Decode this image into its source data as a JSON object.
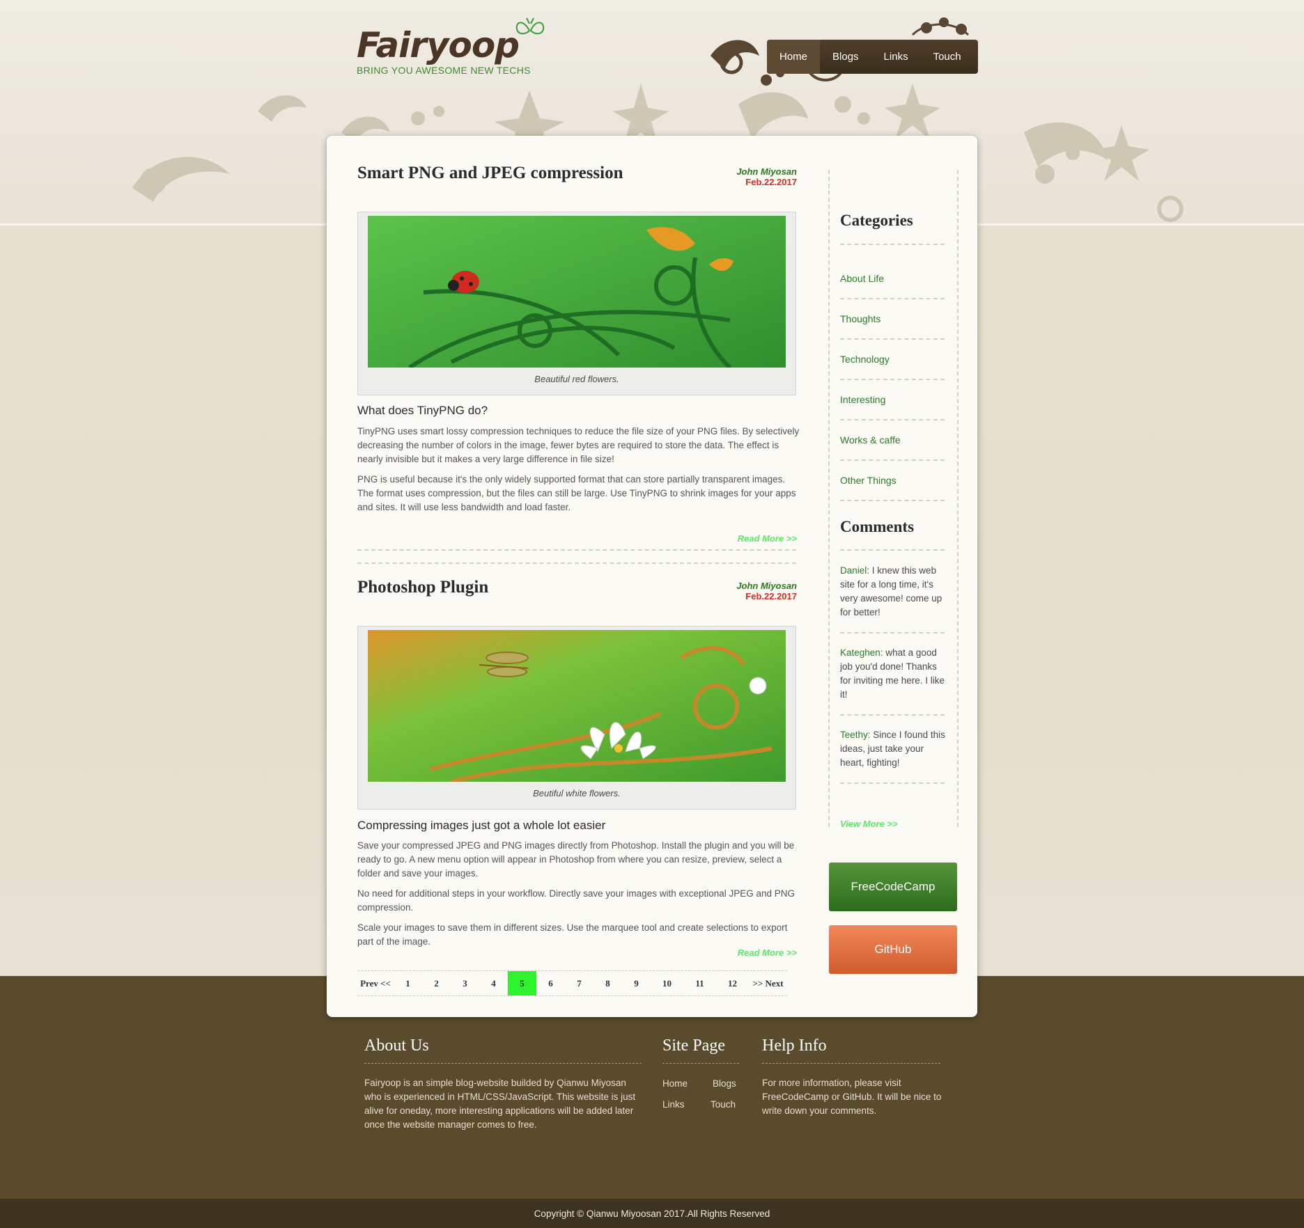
{
  "site": {
    "logo": "Fairyoop",
    "tagline": "BRING YOU AWESOME NEW TECHS"
  },
  "nav": {
    "items": [
      "Home",
      "Blogs",
      "Links",
      "Touch"
    ],
    "active": "Home"
  },
  "posts": [
    {
      "title": "Smart PNG and JPEG compression",
      "author": "John Miyosan",
      "date": "Feb.22.2017",
      "image_caption": "Beautiful red flowers.",
      "subheading": "What does TinyPNG do?",
      "paragraphs": [
        "TinyPNG uses smart lossy compression techniques to reduce the file size of your PNG files. By selectively decreasing the number of colors in the image, fewer bytes are required to store the data. The effect is nearly invisible but it makes a very large difference in file size!",
        "PNG is useful because it's the only widely supported format that can store partially transparent images. The format uses compression, but the files can still be large. Use TinyPNG to shrink images for your apps and sites. It will use less bandwidth and load faster."
      ],
      "read_more": "Read More >>"
    },
    {
      "title": "Photoshop Plugin",
      "author": "John Miyosan",
      "date": "Feb.22.2017",
      "image_caption": "Beutiful white flowers.",
      "subheading": "Compressing images just got a whole lot easier",
      "paragraphs": [
        "Save your compressed JPEG and PNG images directly from Photoshop. Install the plugin and you will be ready to go. A new menu option will appear in Photoshop from where you can resize, preview, select a folder and save your images.",
        "No need for additional steps in your workflow. Directly save your images with exceptional JPEG and PNG compression.",
        "Scale your images to save them in different sizes. Use the marquee tool and create selections to export part of the image."
      ],
      "read_more": "Read More >>"
    }
  ],
  "pagination": {
    "prev": "Prev <<",
    "pages": [
      "1",
      "2",
      "3",
      "4",
      "5",
      "6",
      "7",
      "8",
      "9",
      "10",
      "11",
      "12"
    ],
    "current": "5",
    "next": ">> Next"
  },
  "sidebar": {
    "categories_title": "Categories",
    "categories": [
      "About Life",
      "Thoughts",
      "Technology",
      "Interesting",
      "Works & caffe",
      "Other Things"
    ],
    "comments_title": "Comments",
    "comments": [
      {
        "author": "Daniel:",
        "text": " I knew this web site for a long time, it's very awesome! come up for better!"
      },
      {
        "author": "Kateghen:",
        "text": " what a good job you'd done! Thanks for inviting me here. I like it!"
      },
      {
        "author": "Teethy:",
        "text": " Since I found this ideas, just take your heart, fighting!"
      }
    ],
    "view_more": "View More >>",
    "buttons": [
      "FreeCodeCamp",
      "GitHub"
    ]
  },
  "footer": {
    "about_title": "About Us",
    "about_text": "Fairyoop is an simple blog-website builded by Qianwu Miyosan who is experienced in HTML/CSS/JavaScript. This website is just alive for oneday, more interesting applications will be added later once the website manager comes to free.",
    "site_title": "Site Page",
    "site_links": [
      "Home",
      "Blogs",
      "Links",
      "Touch"
    ],
    "help_title": "Help Info",
    "help_text": "For more information, please visit FreeCodeCamp or GitHub. It will be nice to write down your comments.",
    "copyright": "Copyright © Qianwu Miyoosan 2017.All Rights Reserved"
  },
  "colors": {
    "accent_green": "#2d7a2a",
    "read_more_green": "#5ee86a",
    "date_red": "#d52d1e",
    "nav_brown": "#3b2e1d",
    "footer_brown": "#5a4b2c",
    "pager_active": "#2ef32c"
  }
}
